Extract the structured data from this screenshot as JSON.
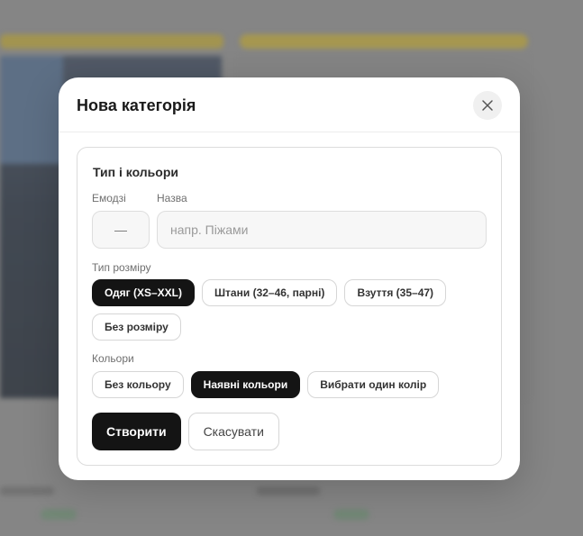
{
  "modal": {
    "title": "Нова категорія",
    "close_icon": "close-icon"
  },
  "section": {
    "title": "Тип і кольори",
    "emoji_label": "Емодзі",
    "emoji_placeholder": "—",
    "name_label": "Назва",
    "name_placeholder": "напр. Піжами",
    "name_value": "",
    "size_type_label": "Тип розміру",
    "size_types": [
      {
        "label": "Одяг (XS–XXL)",
        "selected": true
      },
      {
        "label": "Штани (32–46, парні)",
        "selected": false
      },
      {
        "label": "Взуття (35–47)",
        "selected": false
      },
      {
        "label": "Без розміру",
        "selected": false
      }
    ],
    "colors_label": "Кольори",
    "colors": [
      {
        "label": "Без кольору",
        "selected": false
      },
      {
        "label": "Наявні кольори",
        "selected": true
      },
      {
        "label": "Вибрати один колір",
        "selected": false
      }
    ]
  },
  "actions": {
    "create_label": "Створити",
    "cancel_label": "Скасувати"
  },
  "colors": {
    "accent": "#141414",
    "border": "#dcdcdc",
    "overlay": "#8c8c8c"
  }
}
